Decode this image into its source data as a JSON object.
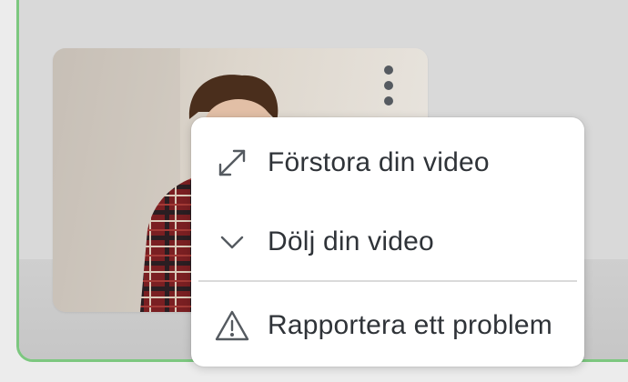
{
  "video": {
    "options_button_icon": "more-vertical-icon"
  },
  "menu": {
    "items": [
      {
        "label": "Förstora din video",
        "icon": "expand-icon"
      },
      {
        "label": "Dölj din video",
        "icon": "chevron-down-icon"
      },
      {
        "label": "Rapportera ett problem",
        "icon": "warning-triangle-icon"
      }
    ]
  },
  "colors": {
    "active_border": "#7cc77f",
    "menu_text": "#2f3338",
    "icon": "#555a60"
  }
}
